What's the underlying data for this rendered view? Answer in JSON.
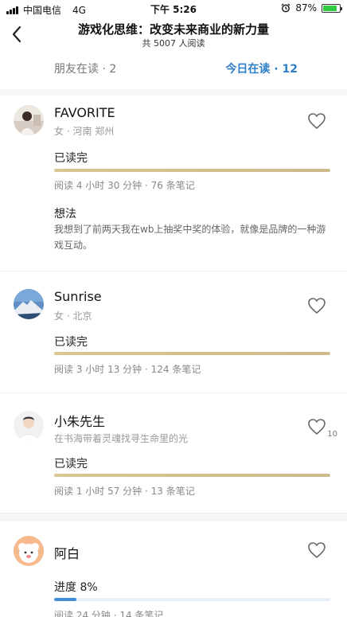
{
  "status_bar": {
    "carrier": "中国电信",
    "network": "4G",
    "time": "下午 5:26",
    "battery_pct": "87%",
    "battery_level": 0.87
  },
  "header": {
    "title": "游戏化思维：改变未来商业的新力量",
    "subtitle": "共 5007 人阅读"
  },
  "tabs": {
    "friends": "朋友在读 · 2",
    "today": "今日在读 · 12"
  },
  "readers": [
    {
      "name": "FAVORITE",
      "meta": "女 · 河南 郑州",
      "status": "已读完",
      "progress": 1.0,
      "stats": "阅读 4 小时 30 分钟 · 76 条笔记",
      "note_title": "想法",
      "note_body": "我想到了前两天我在wb上抽奖中奖的体验，就像是品牌的一种游戏互动。",
      "likes": ""
    },
    {
      "name": "Sunrise",
      "meta": "女 · 北京",
      "status": "已读完",
      "progress": 1.0,
      "stats": "阅读 3 小时 13 分钟 · 124 条笔记",
      "likes": ""
    },
    {
      "name": "小朱先生",
      "meta": "在书海带着灵魂找寻生命里的光",
      "status": "已读完",
      "progress": 1.0,
      "stats": "阅读 1 小时 57 分钟 · 13 条笔记",
      "likes": "10"
    },
    {
      "name": "阿白",
      "meta": "",
      "status": "进度 8%",
      "progress": 0.08,
      "stats": "阅读 24 分钟 · 14 条笔记",
      "likes": ""
    }
  ],
  "icons": {
    "back": "chevron-left-icon",
    "like": "heart-outline-icon",
    "alarm": "alarm-icon"
  },
  "colors": {
    "accent": "#2d7dc8",
    "gold_bar": "#d4c08c",
    "progress_blue": "#3f8ddd"
  }
}
